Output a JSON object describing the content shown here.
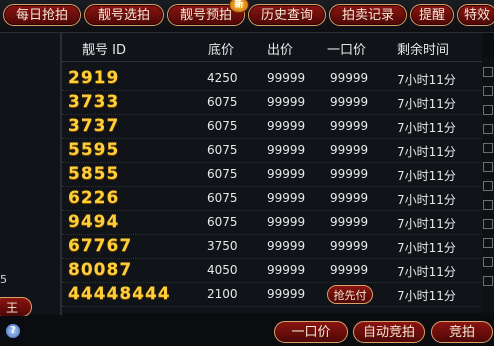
{
  "tabs": [
    "每日抢拍",
    "靓号选拍",
    "靓号预拍",
    "历史查询",
    "拍卖记录",
    "提醒",
    "特效"
  ],
  "new_badge": "新",
  "columns": [
    "靓号 ID",
    "底价",
    "出价",
    "一口价",
    "剩余时间"
  ],
  "rows": [
    {
      "id": "2919",
      "base": "4250",
      "bid": "99999",
      "buyout": "99999",
      "remain": "7小时11分"
    },
    {
      "id": "3733",
      "base": "6075",
      "bid": "99999",
      "buyout": "99999",
      "remain": "7小时11分"
    },
    {
      "id": "3737",
      "base": "6075",
      "bid": "99999",
      "buyout": "99999",
      "remain": "7小时11分"
    },
    {
      "id": "5595",
      "base": "6075",
      "bid": "99999",
      "buyout": "99999",
      "remain": "7小时11分"
    },
    {
      "id": "5855",
      "base": "6075",
      "bid": "99999",
      "buyout": "99999",
      "remain": "7小时11分"
    },
    {
      "id": "6226",
      "base": "6075",
      "bid": "99999",
      "buyout": "99999",
      "remain": "7小时11分"
    },
    {
      "id": "9494",
      "base": "6075",
      "bid": "99999",
      "buyout": "99999",
      "remain": "7小时11分"
    },
    {
      "id": "67767",
      "base": "3750",
      "bid": "99999",
      "buyout": "99999",
      "remain": "7小时11分"
    },
    {
      "id": "80087",
      "base": "4050",
      "bid": "99999",
      "buyout": "99999",
      "remain": "7小时11分"
    },
    {
      "id": "44448444",
      "base": "2100",
      "bid": "99999",
      "buyout": "抢先付",
      "remain": "7小时11分"
    }
  ],
  "left_panel": {
    "number": "5",
    "button": "王"
  },
  "bottom": {
    "help": "?",
    "buyout_button": "一口价",
    "auto_bid_button": "自动竞拍",
    "bid_button": "竞拍"
  }
}
